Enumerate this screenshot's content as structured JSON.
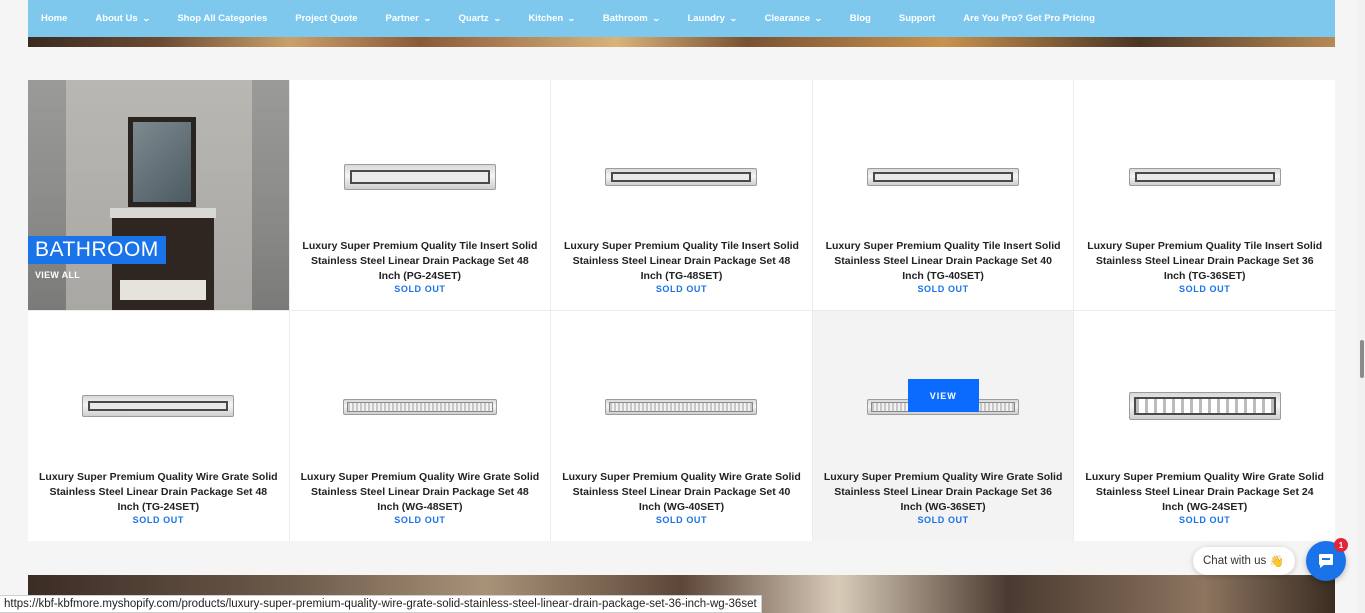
{
  "nav": [
    {
      "label": "Home",
      "has_dropdown": false
    },
    {
      "label": "About Us",
      "has_dropdown": true
    },
    {
      "label": "Shop All Categories",
      "has_dropdown": false
    },
    {
      "label": "Project Quote",
      "has_dropdown": false
    },
    {
      "label": "Partner",
      "has_dropdown": true
    },
    {
      "label": "Quartz",
      "has_dropdown": true
    },
    {
      "label": "Kitchen",
      "has_dropdown": true
    },
    {
      "label": "Bathroom",
      "has_dropdown": true
    },
    {
      "label": "Laundry",
      "has_dropdown": true
    },
    {
      "label": "Clearance",
      "has_dropdown": true
    },
    {
      "label": "Blog",
      "has_dropdown": false
    },
    {
      "label": "Support",
      "has_dropdown": false
    },
    {
      "label": "Are You Pro? Get Pro Pricing",
      "has_dropdown": false
    }
  ],
  "feature": {
    "title": "BATHROOM",
    "link": "VIEW ALL"
  },
  "products": [
    {
      "title": "Luxury Super Premium Quality Tile Insert Solid Stainless Steel Linear Drain Package Set 48 Inch (PG-24SET)",
      "status": "SOLD OUT"
    },
    {
      "title": "Luxury Super Premium Quality Tile Insert Solid Stainless Steel Linear Drain Package Set 48 Inch (TG-48SET)",
      "status": "SOLD OUT"
    },
    {
      "title": "Luxury Super Premium Quality Tile Insert Solid Stainless Steel Linear Drain Package Set 40 Inch (TG-40SET)",
      "status": "SOLD OUT"
    },
    {
      "title": "Luxury Super Premium Quality Tile Insert Solid Stainless Steel Linear Drain Package Set 36 Inch (TG-36SET)",
      "status": "SOLD OUT"
    },
    {
      "title": "Luxury Super Premium Quality Wire Grate Solid Stainless Steel Linear Drain Package Set 48 Inch (TG-24SET)",
      "status": "SOLD OUT"
    },
    {
      "title": "Luxury Super Premium Quality Wire Grate Solid Stainless Steel Linear Drain Package Set 48 Inch (WG-48SET)",
      "status": "SOLD OUT"
    },
    {
      "title": "Luxury Super Premium Quality Wire Grate Solid Stainless Steel Linear Drain Package Set 40 Inch (WG-40SET)",
      "status": "SOLD OUT"
    },
    {
      "title": "Luxury Super Premium Quality Wire Grate Solid Stainless Steel Linear Drain Package Set 36 Inch (WG-36SET)",
      "status": "SOLD OUT",
      "hover_button": "VIEW"
    },
    {
      "title": "Luxury Super Premium Quality Wire Grate Solid Stainless Steel Linear Drain Package Set 24 Inch (WG-24SET)",
      "status": "SOLD OUT"
    }
  ],
  "chat": {
    "label": "Chat with us",
    "emoji": "👋",
    "badge": "1"
  },
  "status_url": "https://kbf-kbfmore.myshopify.com/products/luxury-super-premium-quality-wire-grate-solid-stainless-steel-linear-drain-package-set-36-inch-wg-36set",
  "colors": {
    "nav_bg": "#7ec8ee",
    "accent": "#1a73e8",
    "badge": "#e0263a"
  }
}
